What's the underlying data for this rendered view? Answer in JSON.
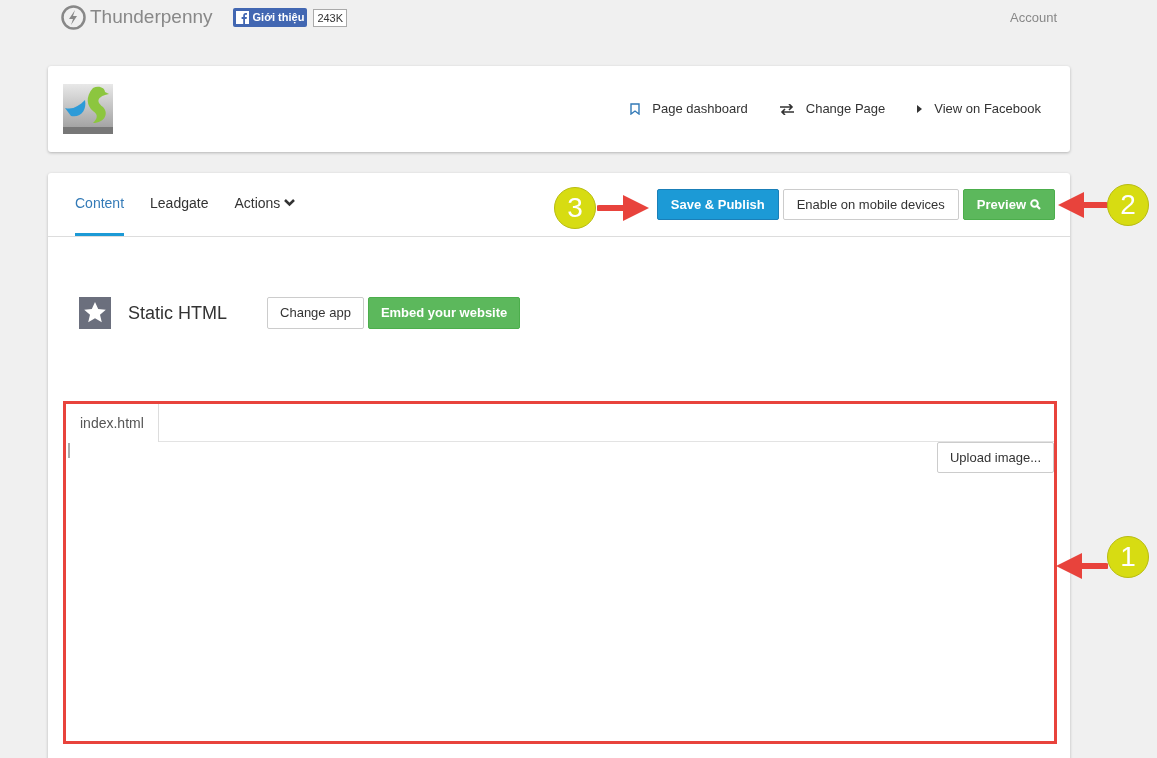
{
  "top_bar": {
    "brand": "Thunderpenny",
    "like_button": "Giới thiệu",
    "like_count": "243K",
    "account_link": "Account"
  },
  "page_header": {
    "links": [
      {
        "kind": "bookmark",
        "label": "Page dashboard"
      },
      {
        "kind": "swap",
        "label": "Change Page"
      },
      {
        "kind": "play",
        "label": "View on Facebook"
      }
    ]
  },
  "tabs": [
    {
      "label": "Content",
      "selected": true,
      "dropdown": false
    },
    {
      "label": "Leadgate",
      "selected": false,
      "dropdown": false
    },
    {
      "label": "Actions",
      "selected": false,
      "dropdown": true
    }
  ],
  "toolbar_buttons": [
    {
      "kind": "primary",
      "label": "Save & Publish",
      "search_icon": false
    },
    {
      "kind": "default",
      "label": "Enable on mobile devices",
      "search_icon": false
    },
    {
      "kind": "success",
      "label": "Preview",
      "search_icon": true
    }
  ],
  "app": {
    "name": "Static HTML",
    "buttons": [
      {
        "kind": "default",
        "label": "Change app"
      },
      {
        "kind": "success",
        "label": "Embed your website"
      }
    ]
  },
  "editor": {
    "file_tabs": [
      {
        "label": "index.html",
        "selected": true
      }
    ],
    "upload_button": "Upload image..."
  },
  "annotations": [
    {
      "number": "1"
    },
    {
      "number": "2"
    },
    {
      "number": "3"
    }
  ]
}
